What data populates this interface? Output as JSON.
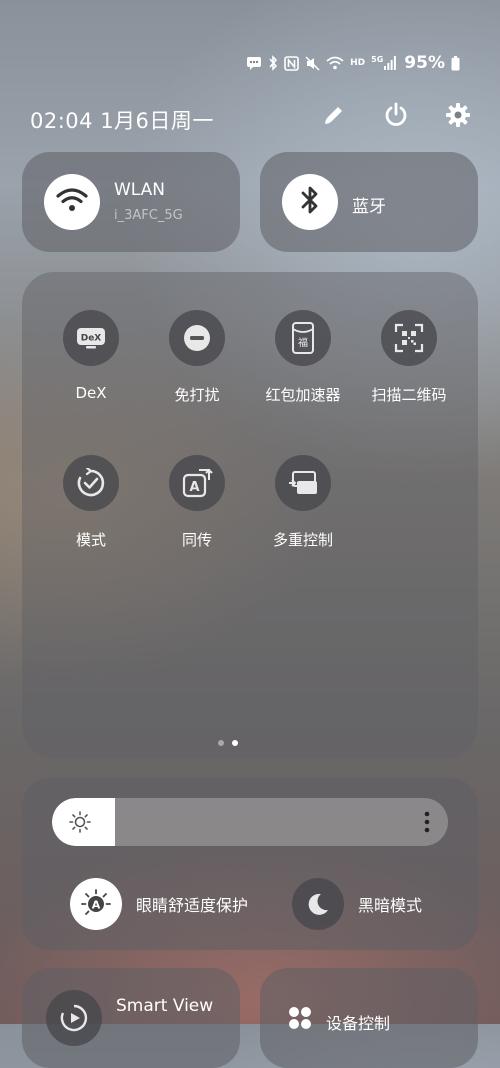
{
  "status_bar": {
    "icons": [
      "message-notification-icon",
      "bluetooth-icon",
      "nfc-icon",
      "mute-icon",
      "wifi-icon",
      "hd-icon",
      "signal-5g-icon",
      "battery-icon"
    ],
    "hd_label": "HD",
    "net_label": "5G",
    "battery": "95%"
  },
  "header": {
    "datetime": "02:04  1月6日周一",
    "actions": [
      "edit-icon",
      "power-icon",
      "settings-icon"
    ]
  },
  "wlan": {
    "title": "WLAN",
    "subtitle": "i_3AFC_5G"
  },
  "bluetooth": {
    "title": "蓝牙"
  },
  "tiles": [
    {
      "label": "DeX",
      "icon": "dex-icon",
      "badge": "DeX"
    },
    {
      "label": "免打扰",
      "icon": "do-not-disturb-icon"
    },
    {
      "label": "红包加速器",
      "icon": "red-envelope-icon",
      "badge": "福"
    },
    {
      "label": "扫描二维码",
      "icon": "qr-scan-icon"
    },
    {
      "label": "模式",
      "icon": "modes-icon"
    },
    {
      "label": "同传",
      "icon": "translate-icon",
      "badge": "A"
    },
    {
      "label": "多重控制",
      "icon": "multi-control-icon"
    }
  ],
  "page_indicator": {
    "pages": 2,
    "current": 2
  },
  "brightness": {
    "level": 0.16
  },
  "eye_comfort": {
    "label": "眼睛舒适度保护",
    "active": true
  },
  "dark_mode": {
    "label": "黑暗模式",
    "active": false
  },
  "smart_view": {
    "title": "Smart View"
  },
  "device_control": {
    "title": "设备控制"
  },
  "colors": {
    "tile_bg": "#5f5f64",
    "active_circle": "#ffffff",
    "text": "#ffffff"
  }
}
